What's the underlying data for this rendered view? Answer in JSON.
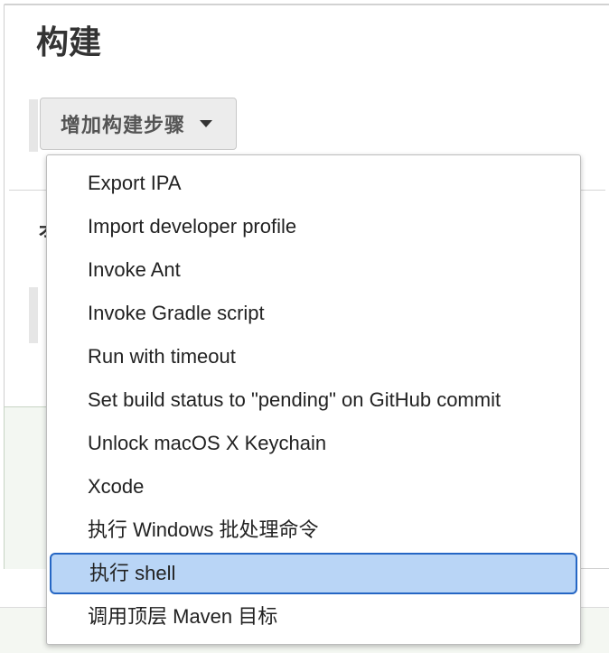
{
  "section": {
    "title": "构建",
    "peek_char": "ォ"
  },
  "add_step_button": {
    "label": "增加构建步骤",
    "icon": "caret-down-icon"
  },
  "dropdown": {
    "items": [
      {
        "label": "Export IPA"
      },
      {
        "label": "Import developer profile"
      },
      {
        "label": "Invoke Ant"
      },
      {
        "label": "Invoke Gradle script"
      },
      {
        "label": "Run with timeout"
      },
      {
        "label": "Set build status to \"pending\" on GitHub commit"
      },
      {
        "label": "Unlock macOS X Keychain"
      },
      {
        "label": "Xcode"
      },
      {
        "label": "执行 Windows 批处理命令"
      },
      {
        "label": "执行 shell",
        "selected": true
      },
      {
        "label": "调用顶层 Maven 目标"
      }
    ]
  },
  "colors": {
    "selected_bg": "#b9d5f6",
    "selected_border": "#2566c4",
    "button_bg": "#ececec"
  }
}
